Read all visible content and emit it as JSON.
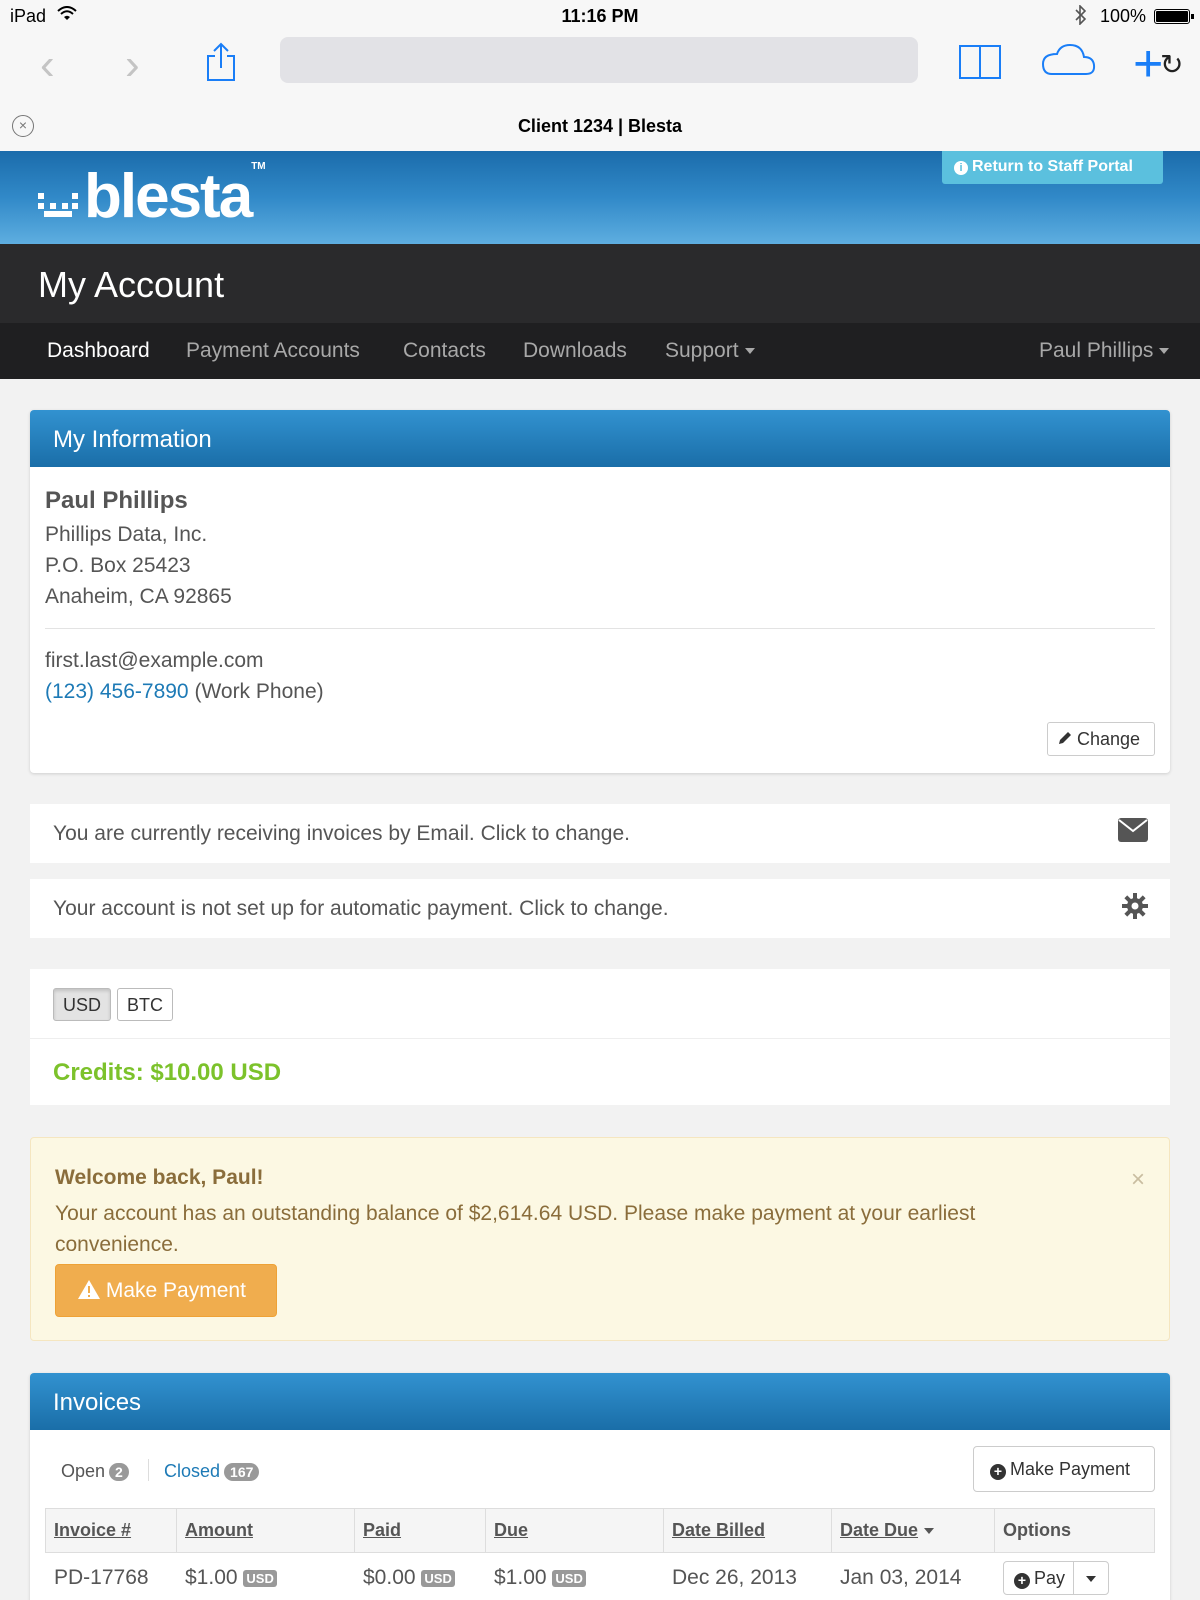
{
  "status": {
    "carrier": "iPad",
    "time": "11:16 PM",
    "battery": "100%"
  },
  "browser": {
    "tab_title": "Client 1234 | Blesta"
  },
  "header": {
    "brand": "blesta",
    "brand_tm": "TM",
    "staff_portal": "Return to Staff Portal",
    "page_title": "My Account"
  },
  "nav": {
    "items": [
      "Dashboard",
      "Payment Accounts",
      "Contacts",
      "Downloads",
      "Support"
    ],
    "user": "Paul Phillips"
  },
  "info": {
    "heading": "My Information",
    "name": "Paul Phillips",
    "company": "Phillips Data, Inc.",
    "address1": "P.O. Box 25423",
    "address2": "Anaheim, CA 92865",
    "email": "first.last@example.com",
    "phone": "(123) 456-7890",
    "phone_type": "(Work Phone)",
    "change_label": "Change"
  },
  "invoice_method": "You are currently receiving invoices by Email. Click to change.",
  "autopay": "Your account is not set up for automatic payment. Click to change.",
  "currencies": [
    "USD",
    "BTC"
  ],
  "credits": "Credits: $10.00 USD",
  "alert": {
    "heading": "Welcome back, Paul!",
    "message": "Your account has an outstanding balance of $2,614.64 USD. Please make payment at your earliest convenience.",
    "button": "Make Payment",
    "close": "×"
  },
  "invoices": {
    "heading": "Invoices",
    "tab_open": "Open",
    "open_count": "2",
    "tab_closed": "Closed",
    "closed_count": "167",
    "make_payment": "Make Payment",
    "columns": [
      "Invoice #",
      "Amount",
      "Paid",
      "Due",
      "Date Billed",
      "Date Due",
      "Options"
    ],
    "rows": [
      {
        "invoice": "PD-17768",
        "amount": "$1.00",
        "paid": "$0.00",
        "due": "$1.00",
        "currency": "USD",
        "billed": "Dec 26, 2013",
        "date_due": "Jan 03, 2014",
        "action": "Pay"
      }
    ]
  }
}
